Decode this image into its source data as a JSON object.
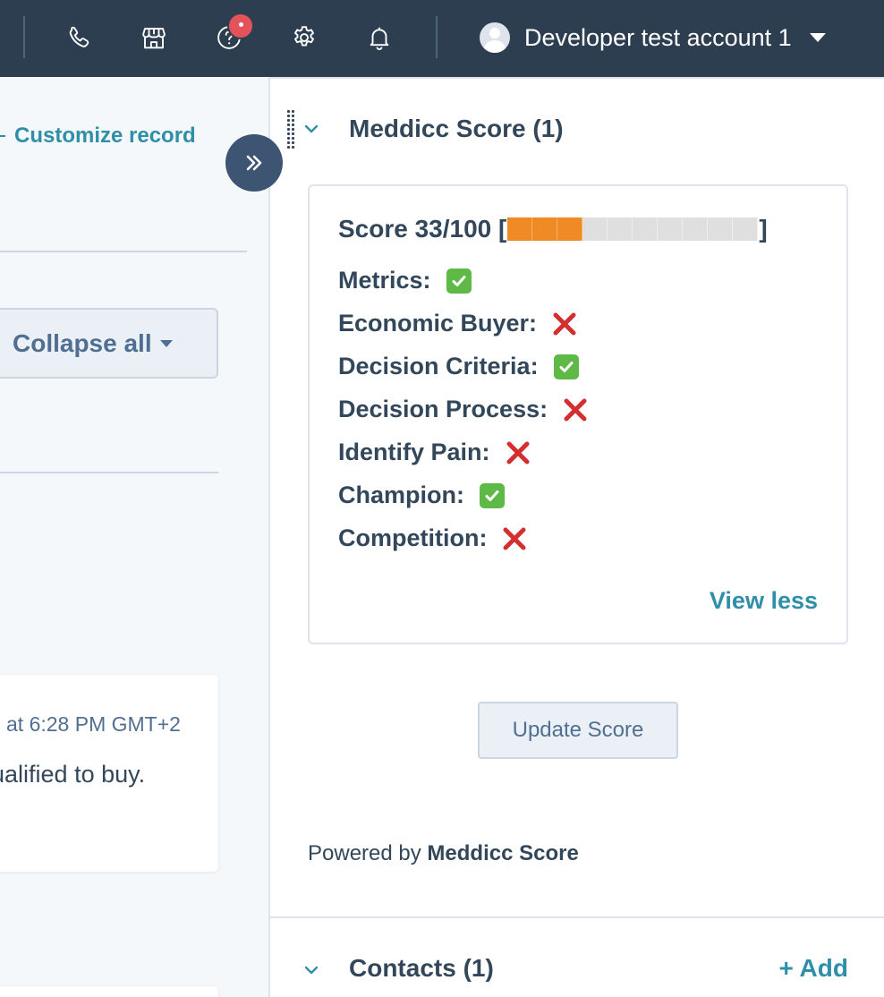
{
  "topbar": {
    "icons": [
      "phone-icon",
      "marketplace-icon",
      "help-icon",
      "settings-icon",
      "bell-icon"
    ],
    "account_name": "Developer test account 1"
  },
  "left": {
    "customize_label": "Customize record",
    "collapse_label": "Collapse all",
    "activity_timestamp": "at 6:28 PM GMT+2",
    "activity_text": "ualified to buy."
  },
  "meddicc": {
    "section_title": "Meddicc Score (1)",
    "score_label": "Score 33/100 [",
    "score_close": "]",
    "score_value": 33,
    "score_max": 100,
    "bar_cells_total": 10,
    "bar_cells_filled": 3,
    "criteria": [
      {
        "label": "Metrics:",
        "met": true
      },
      {
        "label": "Economic Buyer:",
        "met": false
      },
      {
        "label": "Decision Criteria:",
        "met": true
      },
      {
        "label": "Decision Process:",
        "met": false
      },
      {
        "label": "Identify Pain:",
        "met": false
      },
      {
        "label": "Champion:",
        "met": true
      },
      {
        "label": "Competition:",
        "met": false
      }
    ],
    "view_less_label": "View less",
    "update_label": "Update Score",
    "powered_prefix": "Powered by",
    "powered_name": "Meddicc Score"
  },
  "contacts": {
    "section_title": "Contacts (1)",
    "add_label": "+ Add"
  },
  "colors": {
    "topbar": "#2d3e50",
    "link": "#2f8fa8",
    "bar_filled": "#f08a24",
    "bar_empty": "#dfdfdf",
    "check": "#5fb946",
    "cross": "#d32f2f"
  }
}
